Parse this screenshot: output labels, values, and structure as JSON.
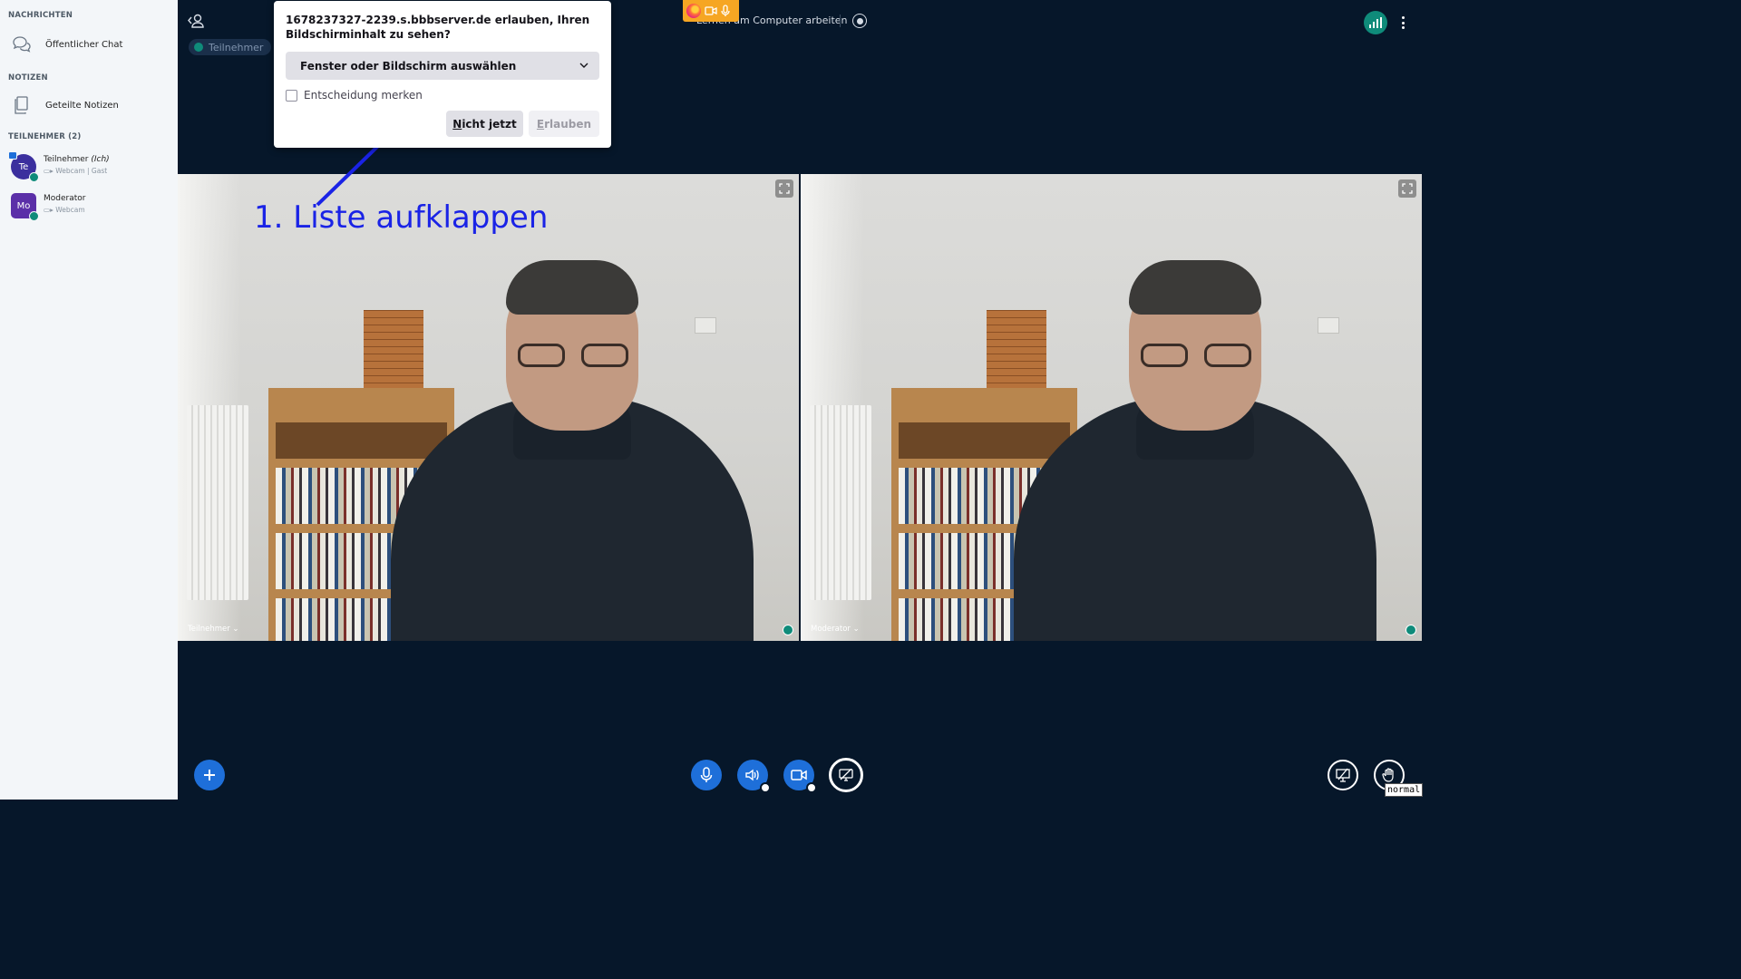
{
  "sidebar": {
    "messages_title": "NACHRICHTEN",
    "public_chat": "Öffentlicher Chat",
    "notes_title": "NOTIZEN",
    "shared_notes": "Geteilte Notizen",
    "participants_title": "TEILNEHMER (2)",
    "users": [
      {
        "initials": "Te",
        "name": "Teilnehmer",
        "me": "(Ich)",
        "sub": "Webcam | Gast",
        "color": "#3b2f9e"
      },
      {
        "initials": "Mo",
        "name": "Moderator",
        "me": "",
        "sub": "Webcam",
        "color": "#5b2fa8"
      }
    ]
  },
  "topbar": {
    "participant_pill": "Teilnehmer",
    "meeting_title": "Lernen am Computer arbeiten"
  },
  "dialog": {
    "prompt": "1678237327-2239.s.bbbserver.de erlauben, Ihren Bildschirminhalt zu sehen?",
    "select_value": "Fenster oder Bildschirm auswählen",
    "remember_label": "Entscheidung merken",
    "not_now_first": "N",
    "not_now_rest": "icht jetzt",
    "allow_first": "E",
    "allow_rest": "rlauben"
  },
  "annotation": {
    "text": "1. Liste aufklappen",
    "color": "#1a23e6"
  },
  "videos": [
    {
      "label": "Teilnehmer"
    },
    {
      "label": "Moderator"
    }
  ],
  "status_tooltip": "normal",
  "colors": {
    "accent": "#1e6fd9",
    "background": "#06172a",
    "sidebar": "#f3f6f9",
    "status_ok": "#0f8b7a"
  },
  "icons": {
    "chat": "chat-bubble-icon",
    "notes": "copy-document-icon",
    "firefox": "firefox-icon",
    "camera": "camera-icon",
    "microphone": "microphone-icon",
    "connection": "signal-bars-icon",
    "more": "vertical-dots-icon",
    "record": "record-icon",
    "add": "plus-icon",
    "audio": "speaker-icon",
    "screen_share": "screen-share-icon",
    "presentation": "presentation-icon",
    "raise_hand": "hand-icon",
    "expand": "fullscreen-icon",
    "toggle_user_list": "user-list-toggle-icon",
    "dropdown": "chevron-down-icon"
  }
}
